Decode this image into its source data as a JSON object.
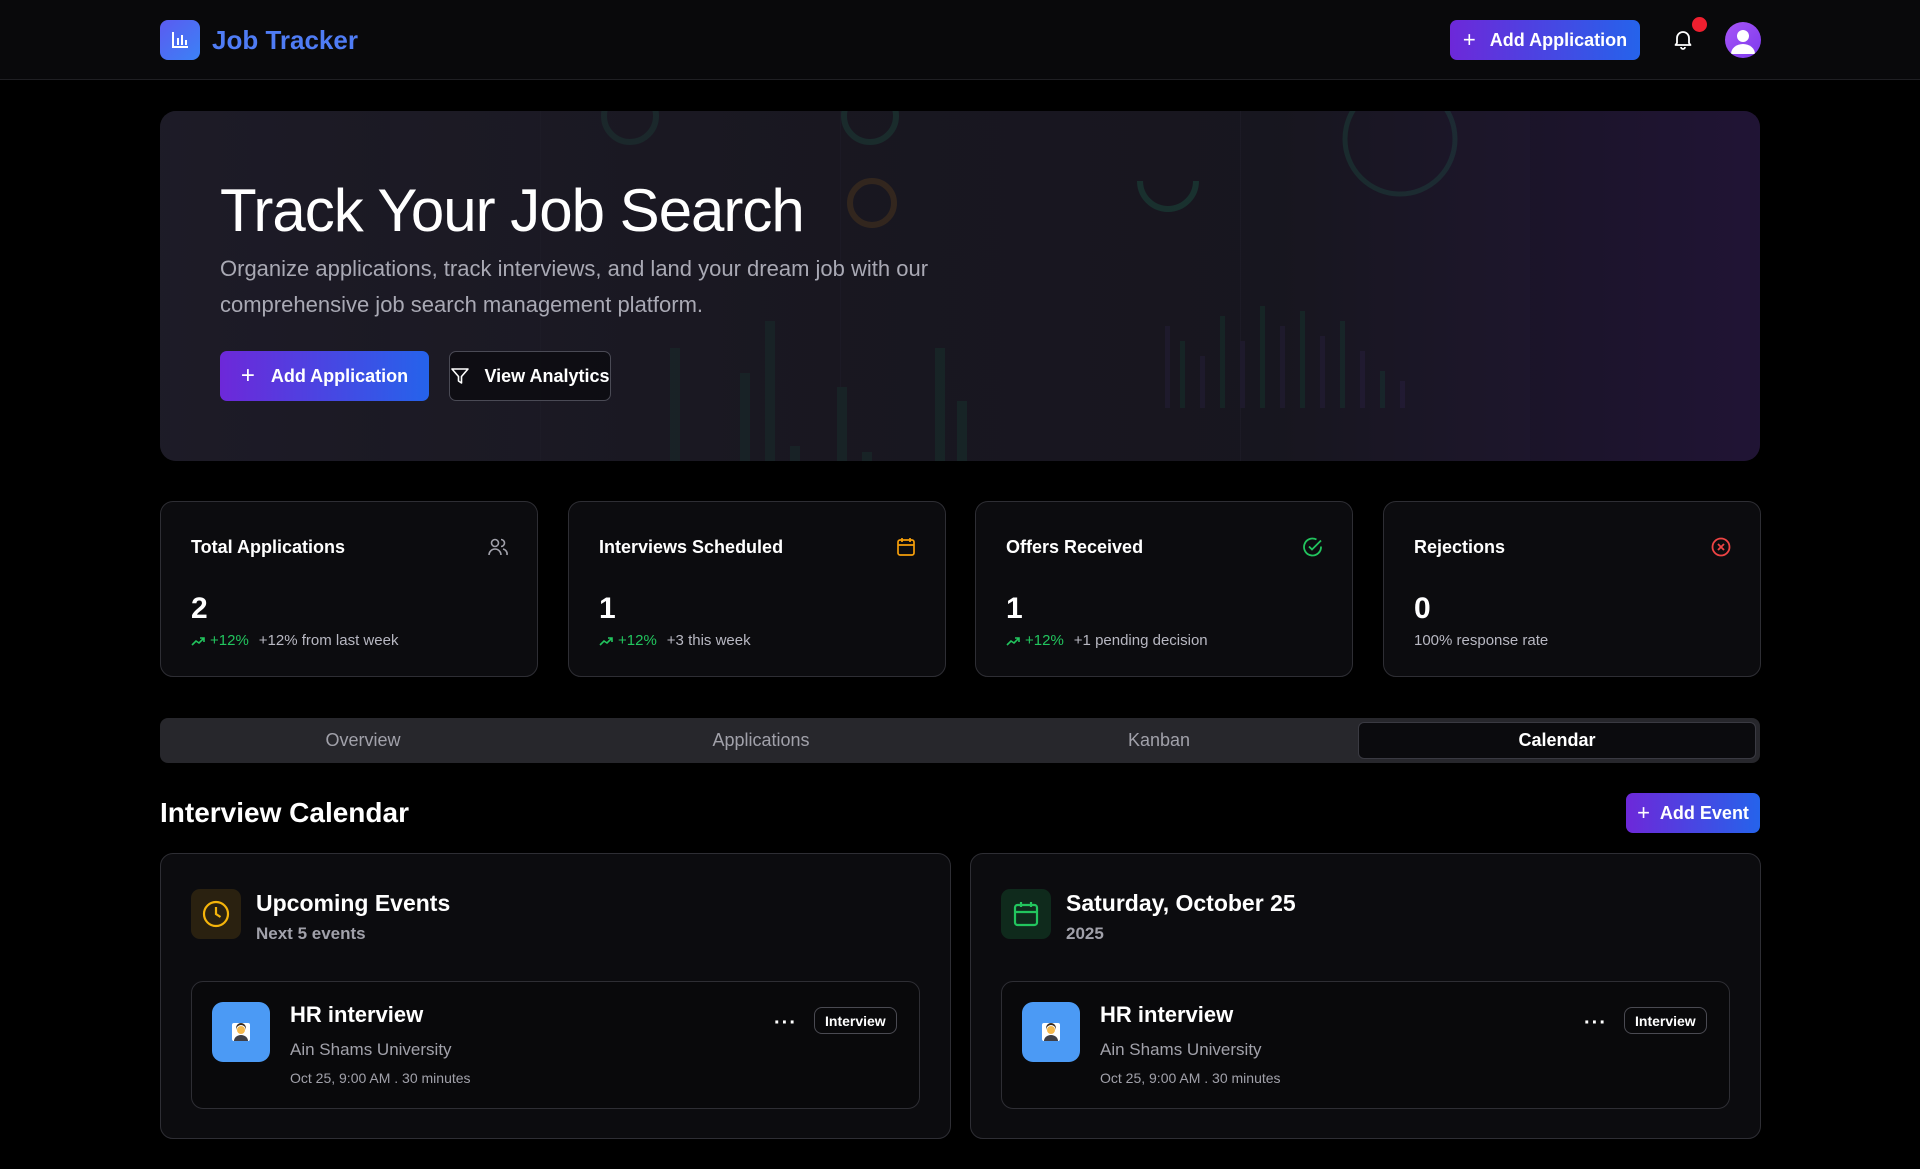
{
  "header": {
    "app_title": "Job Tracker",
    "add_label": "Add Application",
    "logo_icon": "bar-chart-icon",
    "bell_icon": "bell-icon",
    "avatar_icon": "user-icon",
    "accent": "#6d28d9"
  },
  "hero": {
    "title": "Track Your Job Search",
    "subtitle": "Organize applications, track interviews, and land your dream job with our comprehensive job search management platform.",
    "primary_label": "Add Application",
    "secondary_label": "View Analytics",
    "primary_icon": "plus-icon",
    "secondary_icon": "filter-icon"
  },
  "stats": [
    {
      "title": "Total Applications",
      "value": "2",
      "trend": "+12%",
      "note": "+12% from last week",
      "icon": "users-icon",
      "icon_color": "#a1a1aa"
    },
    {
      "title": "Interviews Scheduled",
      "value": "1",
      "trend": "+12%",
      "note": "+3 this week",
      "icon": "calendar-icon",
      "icon_color": "#f59e0b"
    },
    {
      "title": "Offers Received",
      "value": "1",
      "trend": "+12%",
      "note": "+1 pending decision",
      "icon": "check-circle-icon",
      "icon_color": "#22c55e"
    },
    {
      "title": "Rejections",
      "value": "0",
      "trend": "",
      "note": "100% response rate",
      "icon": "x-circle-icon",
      "icon_color": "#ef4444"
    }
  ],
  "tabs": [
    {
      "label": "Overview",
      "active": false
    },
    {
      "label": "Applications",
      "active": false
    },
    {
      "label": "Kanban",
      "active": false
    },
    {
      "label": "Calendar",
      "active": true
    }
  ],
  "calendar": {
    "title": "Interview Calendar",
    "add_event_label": "Add Event",
    "upcoming": {
      "title": "Upcoming Events",
      "subtitle": "Next 5 events",
      "icon": "clock-icon"
    },
    "selected_day": {
      "title": "Saturday, October 25",
      "subtitle": "2025",
      "icon": "calendar-icon"
    },
    "events": [
      {
        "title": "HR interview",
        "company": "Ain Shams University",
        "time": "Oct 25, 9:00 AM . 30 minutes",
        "badge": "Interview",
        "more": "···"
      }
    ]
  }
}
